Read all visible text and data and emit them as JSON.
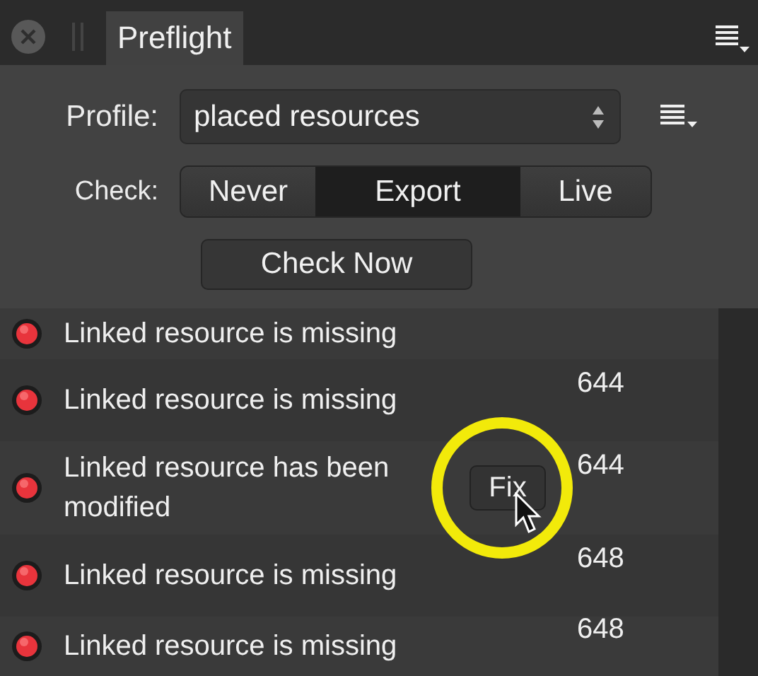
{
  "tabs": [
    {
      "label": "Preflight",
      "selected": true
    }
  ],
  "profile": {
    "label": "Profile:",
    "value": "placed resources"
  },
  "check": {
    "label": "Check:",
    "options": [
      {
        "label": "Never",
        "selected": false
      },
      {
        "label": "Export",
        "selected": true
      },
      {
        "label": "Live",
        "selected": false
      }
    ]
  },
  "check_now": "Check Now",
  "issues": [
    {
      "text": "Linked resource is missing"
    },
    {
      "text": "Linked resource is missing",
      "line": "644"
    },
    {
      "text": "Linked resource has been modified",
      "line": "644",
      "fix_button": "Fix"
    },
    {
      "text": "Linked resource is missing",
      "line": "648"
    },
    {
      "text": "Linked resource is missing",
      "line": "648"
    }
  ]
}
